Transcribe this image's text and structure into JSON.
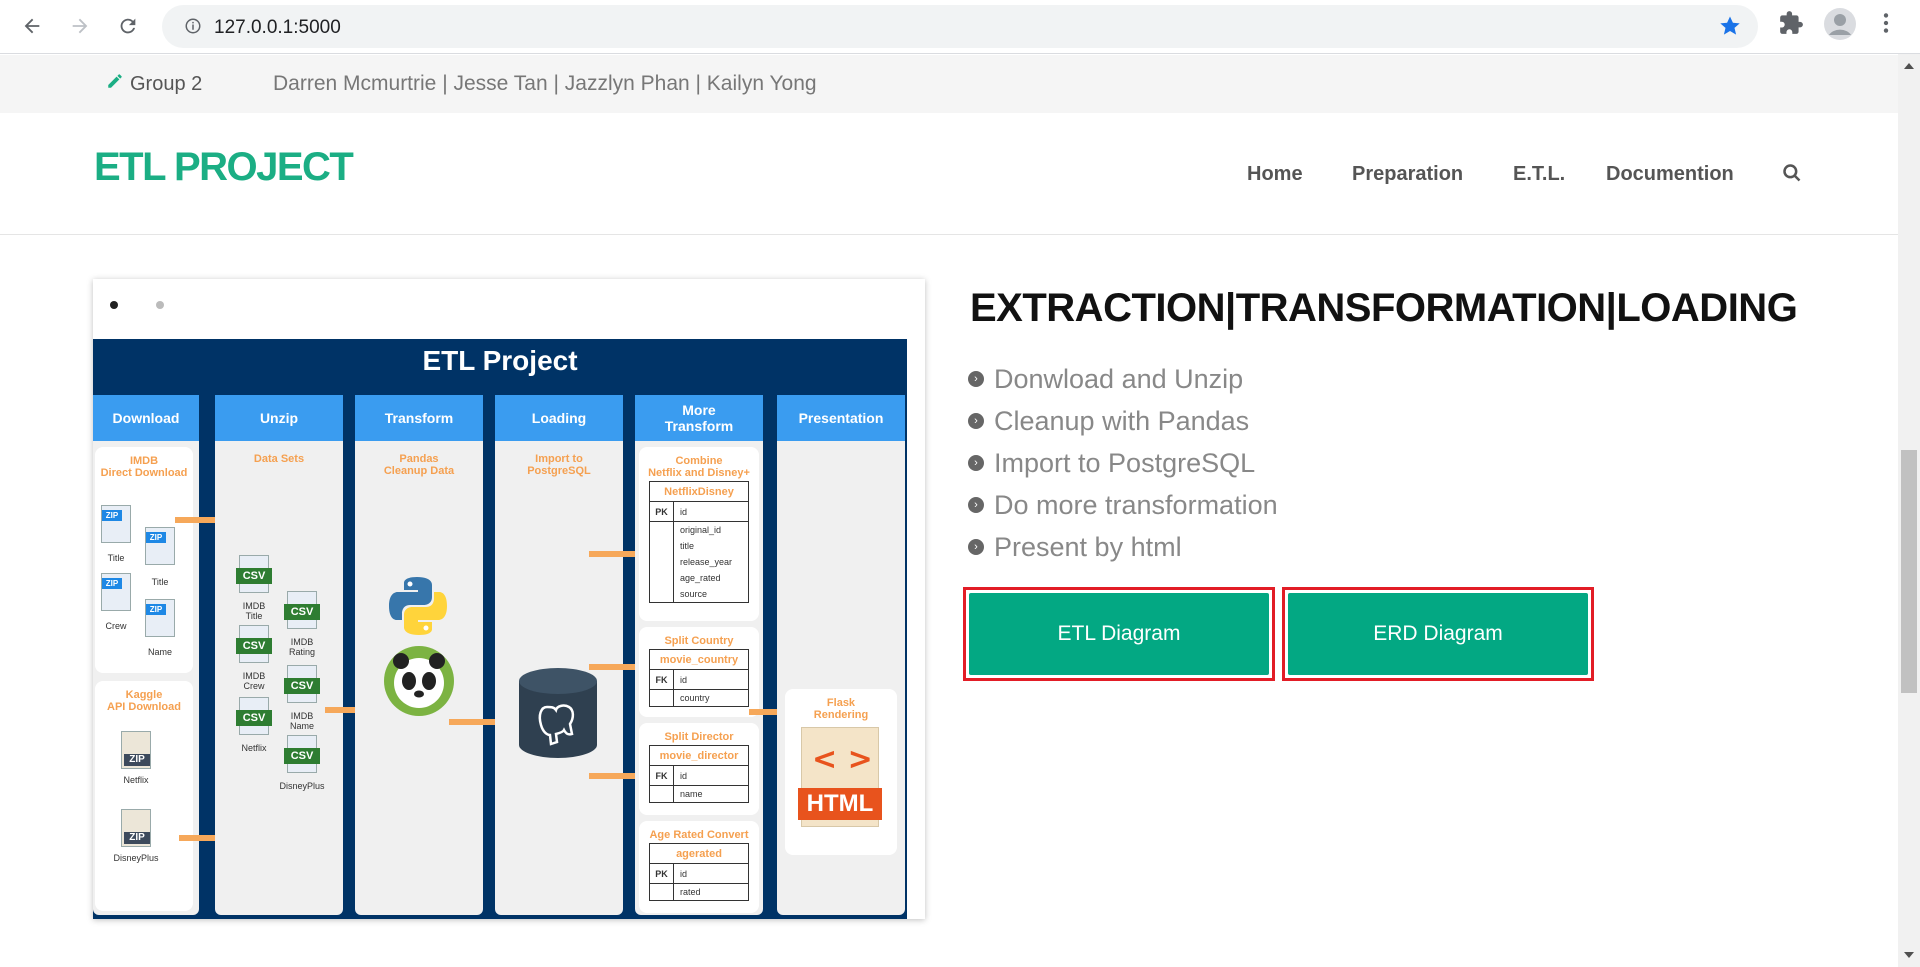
{
  "browser": {
    "url": "127.0.0.1:5000",
    "icons": [
      "back-icon",
      "forward-icon",
      "reload-icon",
      "info-icon",
      "star-icon",
      "extensions-icon",
      "profile-icon",
      "menu-icon"
    ]
  },
  "topbar": {
    "group_label": "Group 2",
    "members": "Darren Mcmurtrie | Jesse Tan | Jazzlyn Phan | Kailyn Yong"
  },
  "header": {
    "logo": "ETL PROJECT",
    "nav": [
      "Home",
      "Preparation",
      "E.T.L.",
      "Documention"
    ]
  },
  "diagram": {
    "title": "ETL Project",
    "columns": [
      "Download",
      "Unzip",
      "Transform",
      "Loading",
      "More\nTransform",
      "Presentation"
    ],
    "labels": {
      "imdb_direct": "IMDB\nDirect Download",
      "kaggle": "Kaggle\nAPI Download",
      "data_sets": "Data Sets",
      "pandas": "Pandas\nCleanup Data",
      "import": "Import to\nPostgreSQL",
      "combine": "Combine\nNetflix and Disney+",
      "split_country": "Split Country",
      "split_director": "Split Director",
      "age_rated": "Age Rated Convert",
      "flask": "Flask\nRendering",
      "html": "HTML"
    },
    "zip_files": [
      "Title",
      "Title",
      "Crew",
      "Name",
      "Netflix",
      "DisneyPlus"
    ],
    "csv_files": [
      "IMDB\nTitle",
      "IMDB\nRating",
      "IMDB\nCrew",
      "IMDB\nName",
      "Netflix",
      "DisneyPlus"
    ],
    "tables": [
      {
        "name": "NetflixDisney",
        "rows": [
          [
            "PK",
            "id"
          ],
          [
            "",
            "original_id"
          ],
          [
            "",
            "title"
          ],
          [
            "",
            "release_year"
          ],
          [
            "",
            "age_rated"
          ],
          [
            "",
            "source"
          ]
        ]
      },
      {
        "name": "movie_country",
        "rows": [
          [
            "FK",
            "id"
          ],
          [
            "",
            "country"
          ]
        ]
      },
      {
        "name": "movie_director",
        "rows": [
          [
            "FK",
            "id"
          ],
          [
            "",
            "name"
          ]
        ]
      },
      {
        "name": "agerated",
        "rows": [
          [
            "PK",
            "id"
          ],
          [
            "",
            "rated"
          ]
        ]
      }
    ]
  },
  "content": {
    "heading": "EXTRACTION|TRANSFORMATION|LOADING",
    "bullets": [
      "Donwload and Unzip",
      "Cleanup with Pandas",
      "Import to PostgreSQL",
      "Do more transformation",
      "Present by html"
    ],
    "buttons": [
      "ETL Diagram",
      "ERD Diagram"
    ]
  },
  "colors": {
    "accent": "#03a883",
    "logo": "#1bae84",
    "highlight": "#e21d26",
    "diagram_bg": "#003366",
    "column_head": "#3a9cf0"
  }
}
